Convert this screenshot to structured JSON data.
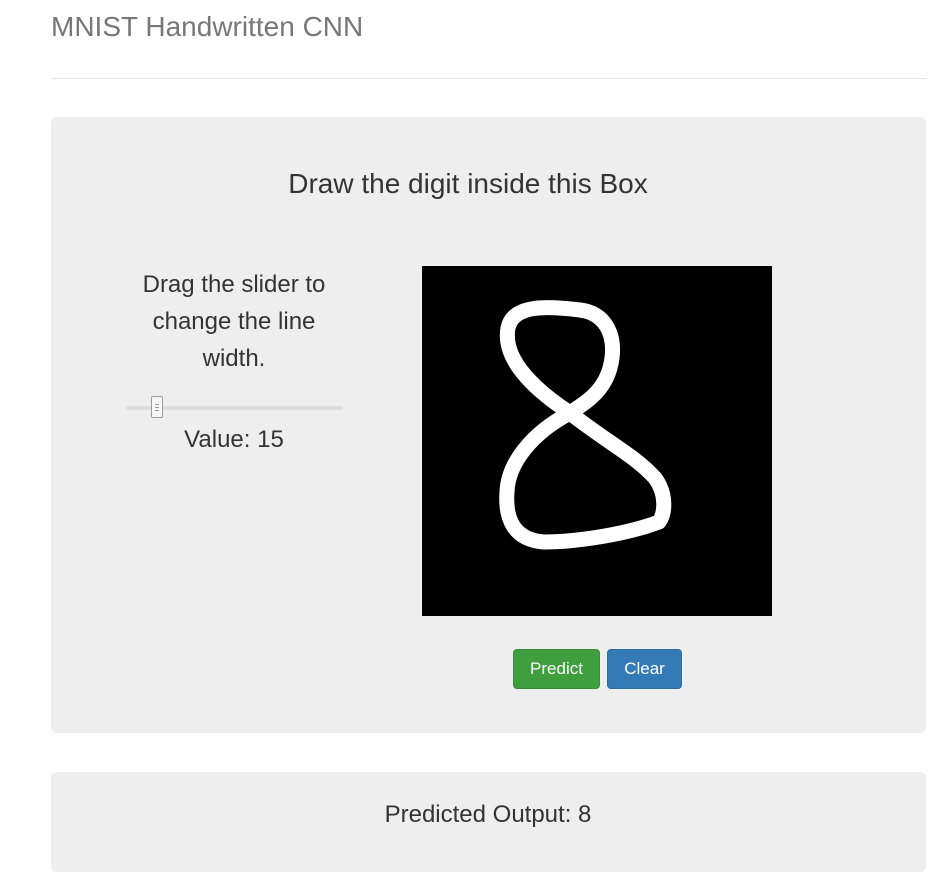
{
  "page": {
    "title": "MNIST Handwritten CNN"
  },
  "draw_panel": {
    "heading": "Draw the digit inside this Box",
    "slider_instruction": "Drag the slider to change the line width.",
    "slider_value_text": "Value: 15",
    "slider_value": 15,
    "canvas_background": "#000000",
    "stroke_color": "#ffffff",
    "drawn_digit": "8"
  },
  "buttons": {
    "predict_label": "Predict",
    "clear_label": "Clear",
    "predict_color": "#3f9f3f",
    "clear_color": "#337ab7"
  },
  "result": {
    "text": "Predicted Output: 8"
  },
  "colors": {
    "panel_background": "#eeeeee",
    "title_text": "#777777",
    "body_text": "#333333"
  }
}
